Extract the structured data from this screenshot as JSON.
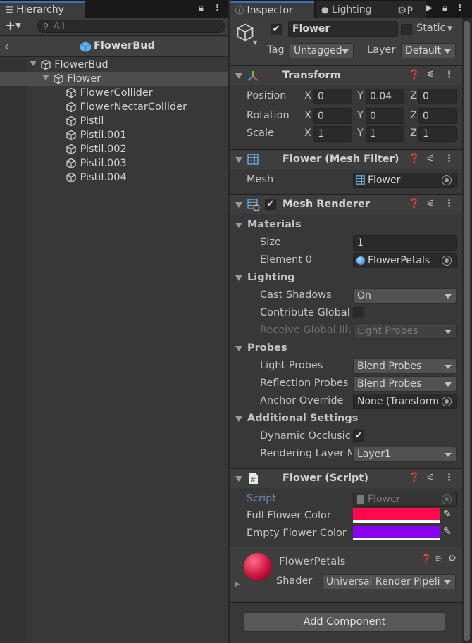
{
  "hierarchy": {
    "tab_label": "Hierarchy",
    "search_placeholder": "All",
    "breadcrumb": "FlowerBud",
    "tree": [
      {
        "label": "FlowerBud"
      },
      {
        "label": "Flower"
      },
      {
        "label": "FlowerCollider"
      },
      {
        "label": "FlowerNectarCollider"
      },
      {
        "label": "Pistil"
      },
      {
        "label": "Pistil.001"
      },
      {
        "label": "Pistil.002"
      },
      {
        "label": "Pistil.003"
      },
      {
        "label": "Pistil.004"
      }
    ]
  },
  "inspector": {
    "tabs": {
      "inspector": "Inspector",
      "lighting": "Lighting",
      "project": "P"
    },
    "object_name": "Flower",
    "static_label": "Static",
    "tag_label": "Tag",
    "tag_value": "Untagged",
    "layer_label": "Layer",
    "layer_value": "Default",
    "transform": {
      "title": "Transform",
      "rows": [
        {
          "label": "Position",
          "x": "0",
          "y": "0.04",
          "z": "0"
        },
        {
          "label": "Rotation",
          "x": "0",
          "y": "0",
          "z": "0"
        },
        {
          "label": "Scale",
          "x": "1",
          "y": "1",
          "z": "1"
        }
      ],
      "axis_x": "X",
      "axis_y": "Y",
      "axis_z": "Z"
    },
    "mesh_filter": {
      "title": "Flower (Mesh Filter)",
      "mesh_label": "Mesh",
      "mesh_value": "Flower"
    },
    "mesh_renderer": {
      "title": "Mesh Renderer",
      "materials": "Materials",
      "size_label": "Size",
      "size_value": "1",
      "element0_label": "Element 0",
      "element0_value": "FlowerPetals",
      "lighting": "Lighting",
      "cast_shadows_label": "Cast Shadows",
      "cast_shadows_value": "On",
      "contribute_gi_label": "Contribute Global",
      "receive_gi_label": "Receive Global Illu",
      "receive_gi_value": "Light Probes",
      "probes": "Probes",
      "light_probes_label": "Light Probes",
      "light_probes_value": "Blend Probes",
      "reflection_probes_label": "Reflection Probes",
      "reflection_probes_value": "Blend Probes",
      "anchor_override_label": "Anchor Override",
      "anchor_override_value": "None (Transform",
      "additional": "Additional Settings",
      "dynamic_occlusion_label": "Dynamic Occlusic",
      "rendering_layer_label": "Rendering Layer M",
      "rendering_layer_value": "Layer1"
    },
    "flower_script": {
      "title": "Flower (Script)",
      "script_label": "Script",
      "script_value": "Flower",
      "full_color_label": "Full Flower Color",
      "full_color": "#ff0a4c",
      "empty_color_label": "Empty Flower Color",
      "empty_color": "#8a00f0"
    },
    "material": {
      "name": "FlowerPetals",
      "shader_label": "Shader",
      "shader_value": "Universal Render Pipeli"
    },
    "add_component": "Add Component"
  }
}
